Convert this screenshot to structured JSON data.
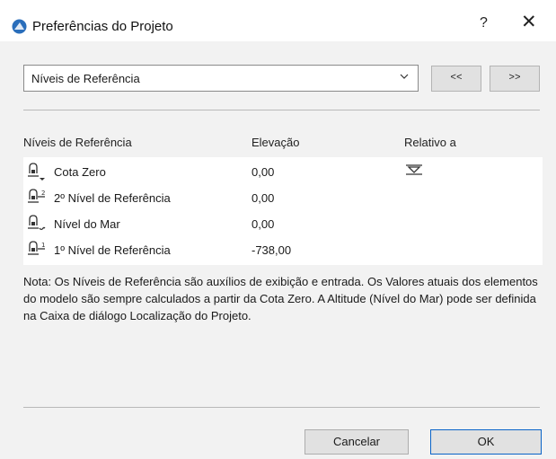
{
  "window": {
    "title": "Preferências do Projeto",
    "help_label": "?",
    "close_label": "✕"
  },
  "category_select": {
    "value": "Níveis de Referência"
  },
  "nav": {
    "prev_label": "<<",
    "next_label": ">>"
  },
  "table": {
    "headers": {
      "name": "Níveis de Referência",
      "elevation": "Elevação",
      "relative": "Relativo a"
    },
    "rows": [
      {
        "name": "Cota Zero",
        "elevation": "0,00",
        "icon": "level-zero-icon",
        "relative_marker": true
      },
      {
        "name": "2º Nível de Referência",
        "elevation": "0,00",
        "icon": "level-2-icon",
        "relative_marker": false
      },
      {
        "name": "Nível do Mar",
        "elevation": "0,00",
        "icon": "sea-level-icon",
        "relative_marker": false
      },
      {
        "name": "1º Nível de Referência",
        "elevation": "-738,00",
        "icon": "level-1-icon",
        "relative_marker": false
      }
    ]
  },
  "note": "Nota: Os Níveis de Referência são auxílios de exibição e entrada. Os Valores atuais dos elementos do modelo são sempre calculados a partir da Cota Zero. A Altitude (Nível do Mar) pode ser definida na Caixa de diálogo Localização do Projeto.",
  "buttons": {
    "cancel_label": "Cancelar",
    "ok_label": "OK"
  },
  "colors": {
    "app_icon": "#2a6ebb",
    "ok_border": "#0a64c8"
  }
}
